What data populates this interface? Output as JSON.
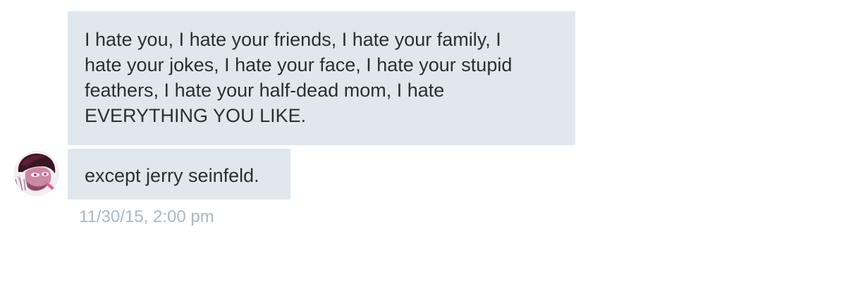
{
  "conversation": {
    "messages": [
      {
        "lines": [
          "I hate you, I hate your friends, I hate your family, I",
          "hate your jokes, I hate your face, I hate your stupid",
          "feathers, I hate your half-dead mom, I hate",
          "EVERYTHING YOU LIKE."
        ]
      },
      {
        "text": "except jerry seinfeld."
      }
    ],
    "timestamp": "11/30/15, 2:00 pm",
    "avatar_icon": "user-avatar-illustration"
  },
  "colors": {
    "bubble_background": "#e1e8ed",
    "message_text": "#292f33",
    "timestamp_text": "#aab8c2",
    "page_background": "#ffffff"
  }
}
